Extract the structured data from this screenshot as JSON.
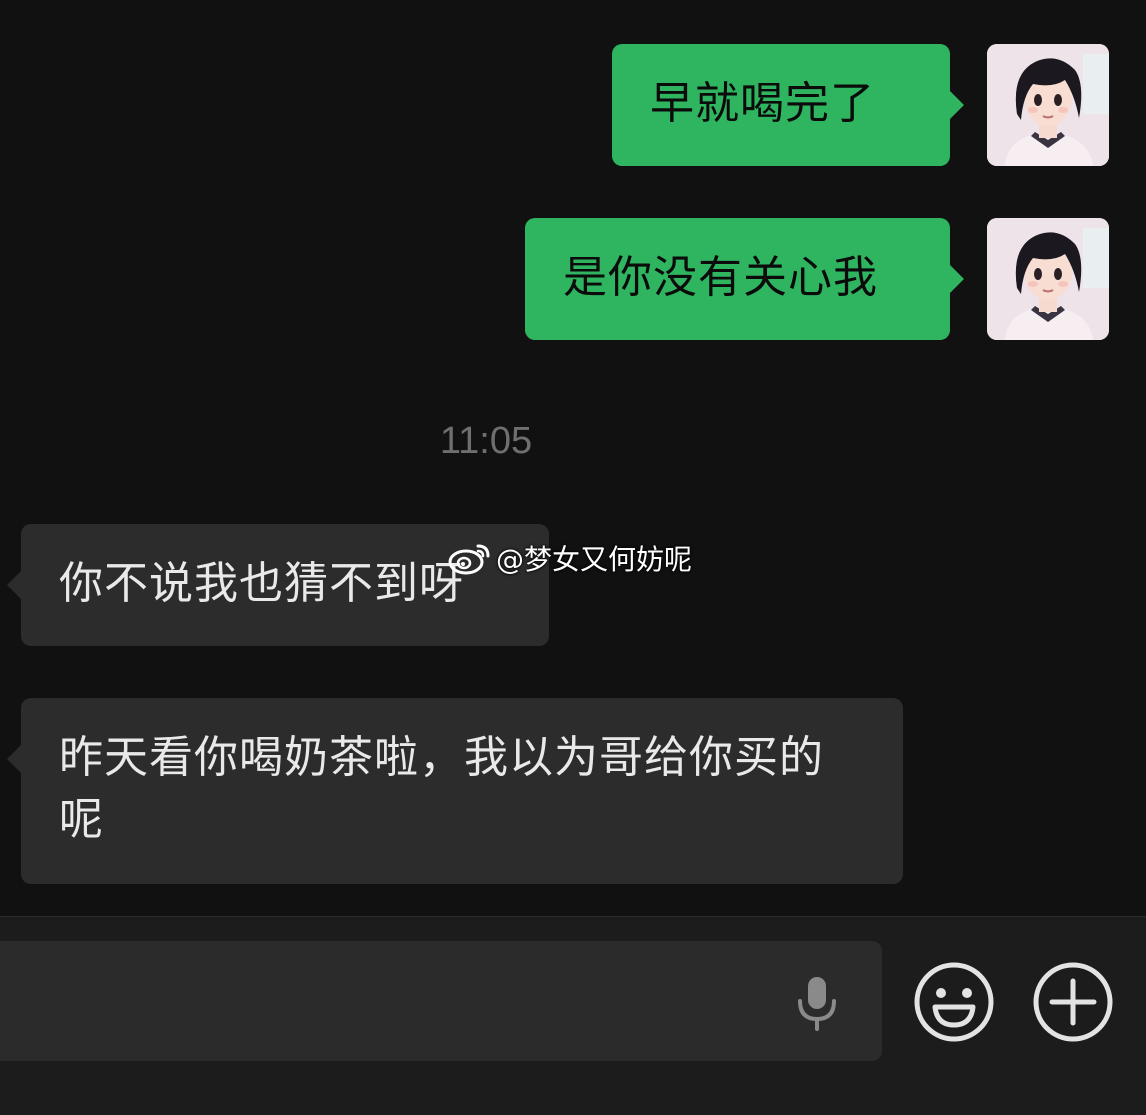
{
  "messages": [
    {
      "side": "out",
      "text": "早就喝完了"
    },
    {
      "side": "out",
      "text": "是你没有关心我"
    },
    {
      "side": "in",
      "text": "你不说我也猜不到呀"
    },
    {
      "side": "in",
      "text": "昨天看你喝奶茶啦，我以为哥给你买的呢"
    }
  ],
  "timestamp": "11:05",
  "watermark": "@梦女又何妨呢",
  "colors": {
    "background": "#111111",
    "outgoing_bubble": "#2fb45f",
    "incoming_bubble": "#2c2c2c",
    "input_bar": "#1c1c1c"
  },
  "icons": {
    "voice": "microphone-icon",
    "emoji": "smiley-face-icon",
    "more": "plus-circle-icon",
    "watermark": "weibo-logo-icon"
  }
}
